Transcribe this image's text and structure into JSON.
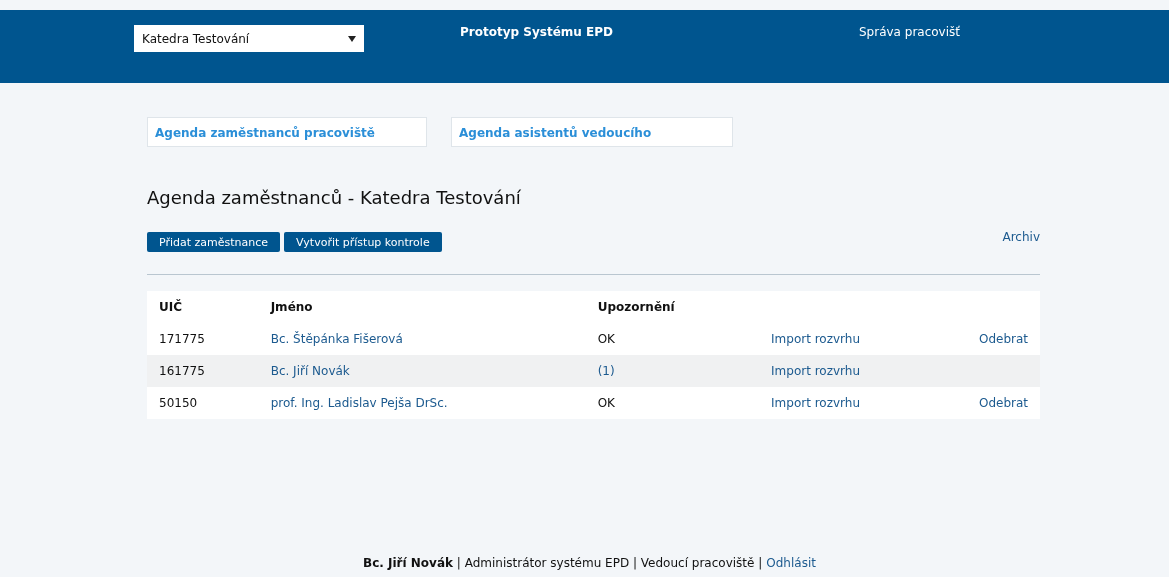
{
  "header": {
    "department_select": {
      "value": "Katedra Testování"
    },
    "title": "Prototyp Systému EPD",
    "nav_link": "Správa pracovišť"
  },
  "agenda_links": [
    "Agenda zaměstnanců pracoviště",
    "Agenda asistentů vedoucího"
  ],
  "heading": "Agenda zaměstnanců - Katedra Testování",
  "buttons": [
    "Přidat zaměstnance",
    "Vytvořit přístup kontrole"
  ],
  "archive_link": "Archiv",
  "table": {
    "columns": [
      "UIČ",
      "Jméno",
      "Upozornění"
    ],
    "rows": [
      {
        "uic": "171775",
        "name": "Bc. Štěpánka Fišerová",
        "alert": {
          "kind": "text",
          "text": "OK"
        },
        "import": "Import rozvrhu",
        "remove": "Odebrat"
      },
      {
        "uic": "161775",
        "name": "Bc. Jiří Novák",
        "alert": {
          "kind": "link",
          "text": "(1)"
        },
        "import": "Import rozvrhu"
      },
      {
        "uic": "50150",
        "name": "prof. Ing. Ladislav Pejša DrSc.",
        "alert": {
          "kind": "text",
          "text": "OK"
        },
        "import": "Import rozvrhu",
        "remove": "Odebrat"
      }
    ]
  },
  "footer": {
    "text": "**Bc. Jiří Novák** | Administrátor systému EPD | Vedoucí pracoviště |",
    "logout": "Odhlásit"
  }
}
